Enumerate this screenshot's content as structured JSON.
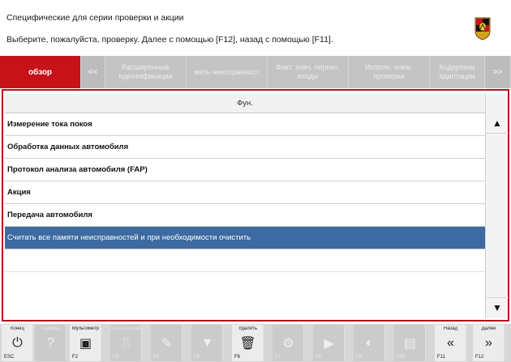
{
  "header": {
    "title": "Специфические для серии проверки и акции",
    "instruction": "Выберите, пожалуйста, проверку. Далее с помощью [F12], назад с помощью [F11]."
  },
  "tabs": [
    {
      "label": "обзор",
      "active": true
    },
    {
      "label": "<<",
      "active": false
    },
    {
      "label": "Расширенные идентификации",
      "active": false
    },
    {
      "label": "мять неисправност",
      "active": false
    },
    {
      "label": "Факт. знач. перекл. входы",
      "active": false
    },
    {
      "label": "Исполн. элем. проверки",
      "active": false
    },
    {
      "label": "Кодировки адаптации",
      "active": false
    },
    {
      "label": ">>",
      "active": false
    }
  ],
  "table": {
    "column_header": "Фун.",
    "rows": [
      {
        "label": "Измерение тока покоя"
      },
      {
        "label": "Обработка данных автомобиля"
      },
      {
        "label": "Протокол анализа автомобиля (FAP)"
      },
      {
        "label": "Акция"
      },
      {
        "label": "Передача автомобиля"
      },
      {
        "label": "Считать все памяти неисправностей и при необходимости очистить",
        "selected": true
      }
    ]
  },
  "scroll": {
    "up": "▲",
    "down": "▼"
  },
  "function_keys": [
    {
      "label": "Конец",
      "fn": "ESC",
      "icon": "power-icon",
      "glyph": "⏻",
      "enabled": true
    },
    {
      "label": "Помощь",
      "fn": "",
      "icon": "help-icon",
      "glyph": "?",
      "enabled": false
    },
    {
      "label": "Мультиметр",
      "fn": "F2",
      "icon": "multimeter-icon",
      "glyph": "▣",
      "enabled": true
    },
    {
      "label": "Осциллограф",
      "fn": "F3",
      "icon": "oscilloscope-icon",
      "glyph": "⎍",
      "enabled": false
    },
    {
      "label": "",
      "fn": "F4",
      "icon": "edit-icon",
      "glyph": "✎",
      "enabled": false
    },
    {
      "label": "",
      "fn": "F5",
      "icon": "filter-icon",
      "glyph": "▼",
      "enabled": false
    },
    {
      "label": "Удалить",
      "fn": "F6",
      "icon": "delete-icon",
      "glyph": "🗑",
      "enabled": true
    },
    {
      "label": "",
      "fn": "F7",
      "icon": "tools-icon",
      "glyph": "⚙",
      "enabled": false
    },
    {
      "label": "",
      "fn": "F8",
      "icon": "play-icon",
      "glyph": "▶",
      "enabled": false
    },
    {
      "label": "",
      "fn": "F9",
      "icon": "component-icon",
      "glyph": "◐",
      "enabled": false
    },
    {
      "label": "",
      "fn": "F10",
      "icon": "document-icon",
      "glyph": "▤",
      "enabled": false
    },
    {
      "label": "Назад",
      "fn": "F11",
      "icon": "back-icon",
      "glyph": "«",
      "enabled": true
    },
    {
      "label": "Далее",
      "fn": "F12",
      "icon": "next-icon",
      "glyph": "»",
      "enabled": true
    }
  ],
  "colors": {
    "accent": "#c8121a",
    "selection": "#3d6aa0",
    "frame": "#b5121b"
  }
}
